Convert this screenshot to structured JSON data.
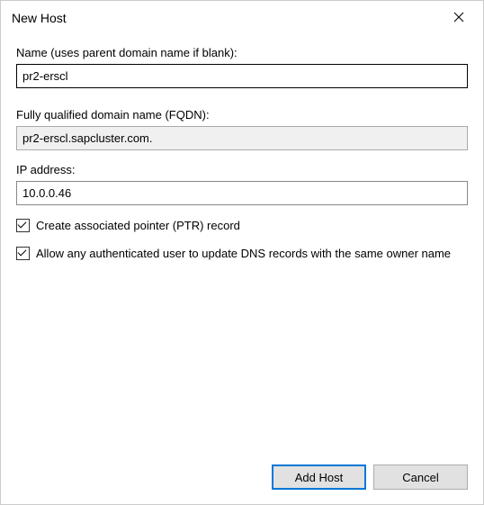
{
  "titlebar": {
    "title": "New Host"
  },
  "fields": {
    "name": {
      "label": "Name (uses parent domain name if blank):",
      "value": "pr2-erscl"
    },
    "fqdn": {
      "label": "Fully qualified domain name (FQDN):",
      "value": "pr2-erscl.sapcluster.com."
    },
    "ip": {
      "label": "IP address:",
      "value": "10.0.0.46"
    }
  },
  "checkboxes": {
    "ptr": {
      "label": "Create associated pointer (PTR) record",
      "checked": true
    },
    "allow_update": {
      "label": "Allow any authenticated user to update DNS records with the same owner name",
      "checked": true
    }
  },
  "buttons": {
    "add_host": "Add Host",
    "cancel": "Cancel"
  }
}
